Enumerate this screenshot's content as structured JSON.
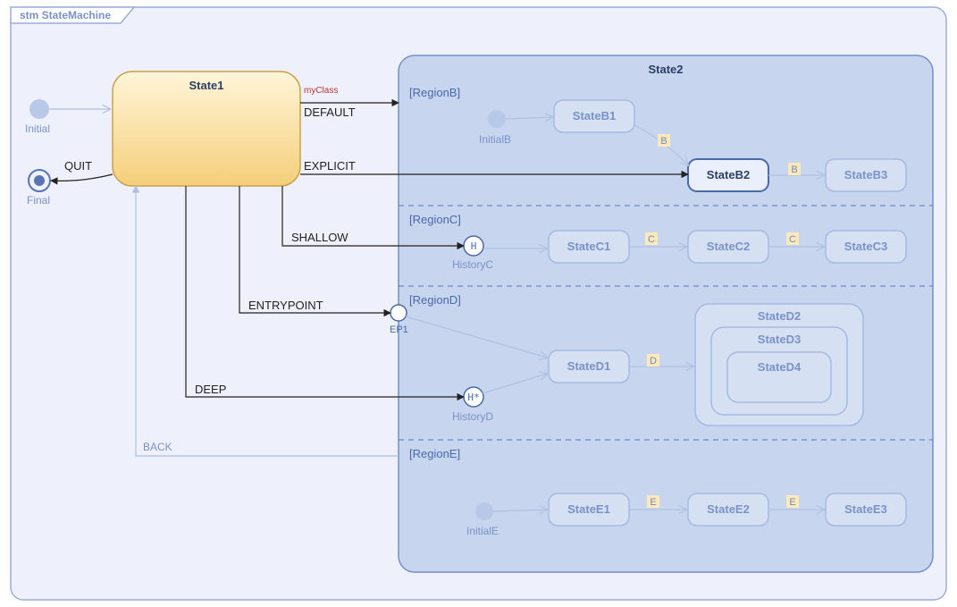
{
  "frame": {
    "title": "stm StateMachine"
  },
  "states": {
    "state1": "State1",
    "state2": "State2",
    "initial": "Initial",
    "final": "Final"
  },
  "transitions": {
    "default": "DEFAULT",
    "explicit": "EXPLICIT",
    "shallow": "SHALLOW",
    "entrypoint": "ENTRYPOINT",
    "deep": "DEEP",
    "quit": "QUIT",
    "back": "BACK",
    "myClass": "myClass"
  },
  "ep": {
    "ep1": "EP1"
  },
  "hist": {
    "c": "HistoryC",
    "d": "HistoryD"
  },
  "regionB": {
    "label": "[RegionB]",
    "initial": "InitialB",
    "s1": "StateB1",
    "s2": "StateB2",
    "s3": "StateB3",
    "g": "B"
  },
  "regionC": {
    "label": "[RegionC]",
    "s1": "StateC1",
    "s2": "StateC2",
    "s3": "StateC3",
    "g": "C"
  },
  "regionD": {
    "label": "[RegionD]",
    "s1": "StateD1",
    "s2": "StateD2",
    "s3": "StateD3",
    "s4": "StateD4",
    "g": "D"
  },
  "regionE": {
    "label": "[RegionE]",
    "initial": "InitialE",
    "s1": "StateE1",
    "s2": "StateE2",
    "s3": "StateE3",
    "g": "E"
  },
  "chart_data": {
    "type": "state-machine",
    "frame_name": "StateMachine",
    "top_states": [
      "Initial",
      "Final",
      "State1",
      "State2"
    ],
    "composite": {
      "State2": {
        "regions": {
          "RegionB": {
            "initial": "InitialB",
            "states": [
              "StateB1",
              "StateB2",
              "StateB3"
            ],
            "shallow_history": false
          },
          "RegionC": {
            "states": [
              "StateC1",
              "StateC2",
              "StateC3"
            ],
            "shallow_history": "HistoryC"
          },
          "RegionD": {
            "states": [
              "StateD1",
              "StateD2",
              "StateD3",
              "StateD4"
            ],
            "deep_history": "HistoryD",
            "nesting": {
              "StateD2": {
                "StateD3": {
                  "StateD4": {}
                }
              }
            }
          },
          "RegionE": {
            "initial": "InitialE",
            "states": [
              "StateE1",
              "StateE2",
              "StateE3"
            ]
          }
        },
        "entry_points": [
          "EP1"
        ]
      }
    },
    "transitions": [
      {
        "from": "Initial",
        "to": "State1",
        "trigger": ""
      },
      {
        "from": "State1",
        "to": "Final",
        "trigger": "QUIT"
      },
      {
        "from": "State1",
        "to": "State2",
        "trigger": "DEFAULT",
        "stereotype": "myClass",
        "target_kind": "composite-boundary"
      },
      {
        "from": "State1",
        "to": "StateB2",
        "trigger": "EXPLICIT",
        "target_kind": "substate"
      },
      {
        "from": "State1",
        "to": "HistoryC",
        "trigger": "SHALLOW",
        "target_kind": "shallowHistory"
      },
      {
        "from": "State1",
        "to": "EP1",
        "trigger": "ENTRYPOINT",
        "target_kind": "entryPoint"
      },
      {
        "from": "State1",
        "to": "HistoryD",
        "trigger": "DEEP",
        "target_kind": "deepHistory"
      },
      {
        "from": "State2",
        "to": "State1",
        "trigger": "BACK"
      },
      {
        "from": "InitialB",
        "to": "StateB1",
        "trigger": ""
      },
      {
        "from": "StateB1",
        "to": "StateB2",
        "trigger": "B"
      },
      {
        "from": "StateB2",
        "to": "StateB3",
        "trigger": "B"
      },
      {
        "from": "HistoryC",
        "to": "StateC1",
        "trigger": ""
      },
      {
        "from": "StateC1",
        "to": "StateC2",
        "trigger": "C"
      },
      {
        "from": "StateC2",
        "to": "StateC3",
        "trigger": "C"
      },
      {
        "from": "EP1",
        "to": "StateD1",
        "trigger": ""
      },
      {
        "from": "StateD1",
        "to": "StateD2",
        "trigger": "D"
      },
      {
        "from": "HistoryD",
        "to": "StateD1",
        "trigger": ""
      },
      {
        "from": "InitialE",
        "to": "StateE1",
        "trigger": ""
      },
      {
        "from": "StateE1",
        "to": "StateE2",
        "trigger": "E"
      },
      {
        "from": "StateE2",
        "to": "StateE3",
        "trigger": "E"
      }
    ]
  }
}
